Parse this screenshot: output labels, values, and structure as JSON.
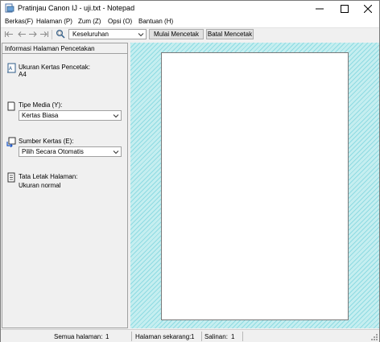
{
  "window": {
    "title": "Pratinjau Canon IJ - uji.txt - Notepad",
    "controls": {
      "minimize": "minimize",
      "maximize": "maximize",
      "close": "close"
    }
  },
  "menu": [
    {
      "label": "Berkas(F)"
    },
    {
      "label": "Halaman (P)"
    },
    {
      "label": "Zum (Z)"
    },
    {
      "label": "Opsi (O)"
    },
    {
      "label": "Bantuan (H)"
    }
  ],
  "toolbar": {
    "icons": [
      "first-page-icon",
      "previous-page-icon",
      "next-page-icon",
      "last-page-icon",
      "zoom-icon"
    ],
    "zoom_value": "Keseluruhan",
    "start_label": "Mulai Mencetak",
    "cancel_label": "Batal Mencetak"
  },
  "panel": {
    "header": "Informasi Halaman Pencetakan",
    "paper_size_label": "Ukuran Kertas Pencetak:",
    "paper_size_value": "A4",
    "media_label": "Tipe Media (Y):",
    "media_value": "Kertas Biasa",
    "source_label": "Sumber Kertas (E):",
    "source_value": "Pilih Secara Otomatis",
    "layout_label": "Tata Letak Halaman:",
    "layout_value": "Ukuran normal"
  },
  "status": {
    "total_pages_label": "Semua halaman:",
    "total_pages_value": "1",
    "current_page_label": "Halaman sekarang:",
    "current_page_value": "1",
    "copies_label": "Salinan:",
    "copies_value": "1"
  },
  "colors": {
    "preview_background": "#c5eef0",
    "preview_hatch": "#8fdbe2",
    "paper": "#ffffff",
    "chrome": "#f0f0f0"
  }
}
